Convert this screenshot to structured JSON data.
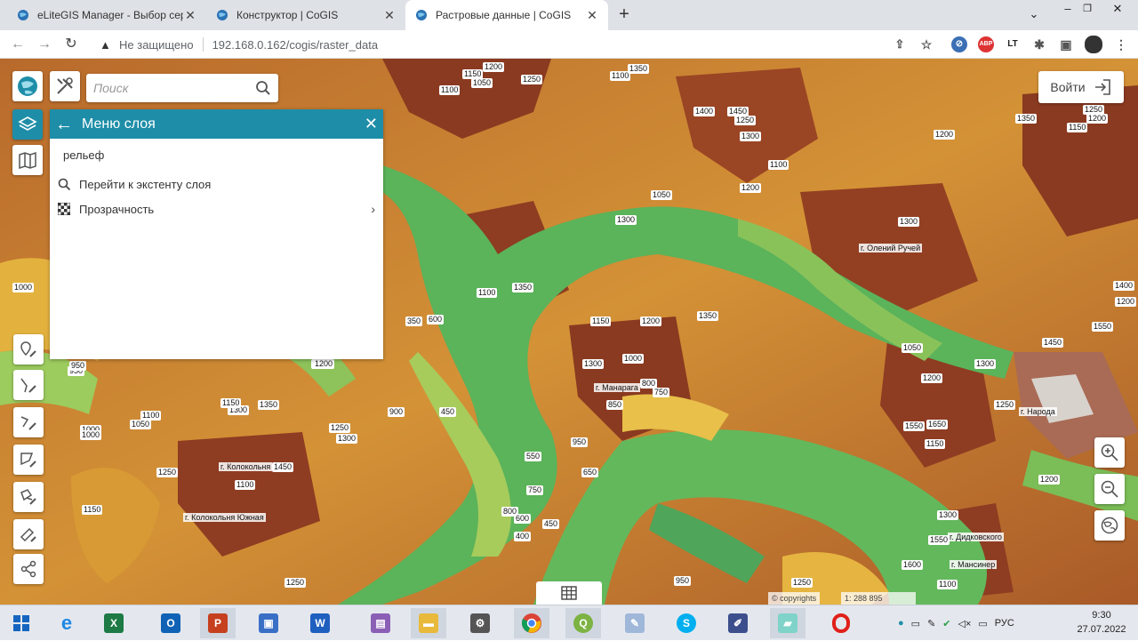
{
  "browser": {
    "tabs": [
      {
        "title": "eLiteGIS Manager - Выбор серв…",
        "active": false
      },
      {
        "title": "Конструктор | CoGIS",
        "active": false
      },
      {
        "title": "Растровые данные | CoGIS",
        "active": true
      }
    ],
    "new_tab": "+",
    "security": "Не защищено",
    "url": "192.168.0.162/cogis/raster_data",
    "extension_abp": "ABP",
    "extension_lt": "LT"
  },
  "map": {
    "search_placeholder": "Поиск",
    "login_label": "Войти",
    "copyright": "© copyrights",
    "scale": "1: 288 895",
    "peaks": [
      {
        "name": "г. Олений Ручей"
      },
      {
        "name": "г. Манарага"
      },
      {
        "name": "г. Народа"
      },
      {
        "name": "г. Колокольня"
      },
      {
        "name": "г. Колокольня Южная"
      },
      {
        "name": "г. Дидковского"
      },
      {
        "name": "г. Мансинер"
      }
    ],
    "contour_labels": [
      "1100",
      "1150",
      "1050",
      "1200",
      "1250",
      "1100",
      "1350",
      "1450",
      "1250",
      "1400",
      "1300",
      "1200",
      "1150",
      "1200",
      "1350",
      "1250",
      "1050",
      "1300",
      "1100",
      "1200",
      "1350",
      "1100",
      "1150",
      "600",
      "1300",
      "1200",
      "1350",
      "350",
      "1300",
      "1000",
      "850",
      "800",
      "750",
      "950",
      "550",
      "650",
      "750",
      "800",
      "600",
      "450",
      "400",
      "450",
      "1050",
      "1100",
      "1300",
      "1350",
      "1250",
      "1300",
      "1200",
      "1450",
      "1250",
      "950",
      "1100",
      "1000",
      "1150",
      "1300",
      "1250",
      "1550",
      "1150",
      "1050",
      "1450",
      "1200",
      "1550",
      "1650",
      "1300",
      "1400",
      "1200",
      "1600",
      "1550",
      "950",
      "1100",
      "1250",
      "1250",
      "1150",
      "1200",
      "1200",
      "1000",
      "900",
      "1000",
      "950"
    ]
  },
  "layer_menu": {
    "title": "Меню слоя",
    "layer_name": "рельеф",
    "items": [
      {
        "label": "Перейти к экстенту слоя",
        "icon": "search-icon"
      },
      {
        "label": "Прозрачность",
        "icon": "checkerboard-icon"
      }
    ]
  },
  "taskbar": {
    "language": "РУС",
    "time": "9:30",
    "date": "27.07.2022",
    "apps": [
      {
        "name": "start-button"
      },
      {
        "name": "internet-explorer-icon"
      },
      {
        "name": "excel-icon",
        "letter": "X"
      },
      {
        "name": "outlook-icon",
        "letter": "O"
      },
      {
        "name": "powerpoint-icon",
        "letter": "P"
      },
      {
        "name": "remote-desktop-icon"
      },
      {
        "name": "word-icon",
        "letter": "W"
      },
      {
        "name": "winrar-icon"
      },
      {
        "name": "file-explorer-icon"
      },
      {
        "name": "settings-app-icon"
      },
      {
        "name": "chrome-icon"
      },
      {
        "name": "qgis-icon"
      },
      {
        "name": "paint-icon"
      },
      {
        "name": "skype-icon",
        "letter": "S"
      },
      {
        "name": "editor-icon"
      },
      {
        "name": "notes-icon"
      },
      {
        "name": "opera-icon"
      }
    ]
  },
  "colors": {
    "accent": "#1e8ea8",
    "terrain_low": "#4caa50",
    "terrain_mid": "#e0a030",
    "terrain_high": "#8a3a20"
  }
}
